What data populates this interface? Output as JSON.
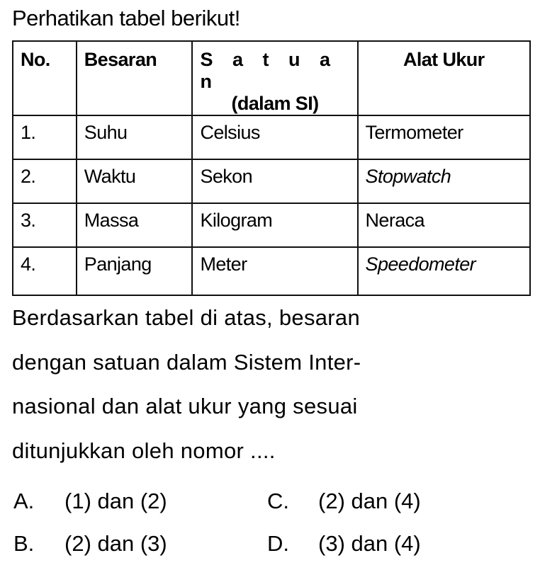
{
  "title": "Perhatikan tabel berikut!",
  "table": {
    "headers": [
      "No.",
      "Besaran",
      "S a t u a n",
      "(dalam SI)",
      "Alat Ukur"
    ],
    "rows": [
      {
        "no": "1.",
        "besaran": "Suhu",
        "satuan": "Celsius",
        "alat": "Termometer"
      },
      {
        "no": "2.",
        "besaran": "Waktu",
        "satuan": "Sekon",
        "alat": "Stopwatch"
      },
      {
        "no": "3.",
        "besaran": "Massa",
        "satuan": "Kilogram",
        "alat": "Neraca"
      },
      {
        "no": "4.",
        "besaran": "Panjang",
        "satuan": "Meter",
        "alat": "Speedometer"
      }
    ]
  },
  "question": {
    "lines": [
      "Berdasarkan tabel di atas, besaran",
      "dengan satuan dalam Sistem Inter-",
      "nasional dan alat ukur yang sesuai",
      "ditunjukkan oleh nomor ...."
    ]
  },
  "options": [
    {
      "label": "A.",
      "text": "(1) dan (2)"
    },
    {
      "label": "B.",
      "text": "(2) dan (3)"
    },
    {
      "label": "C.",
      "text": "(2) dan (4)"
    },
    {
      "label": "D.",
      "text": "(3) dan (4)"
    }
  ]
}
